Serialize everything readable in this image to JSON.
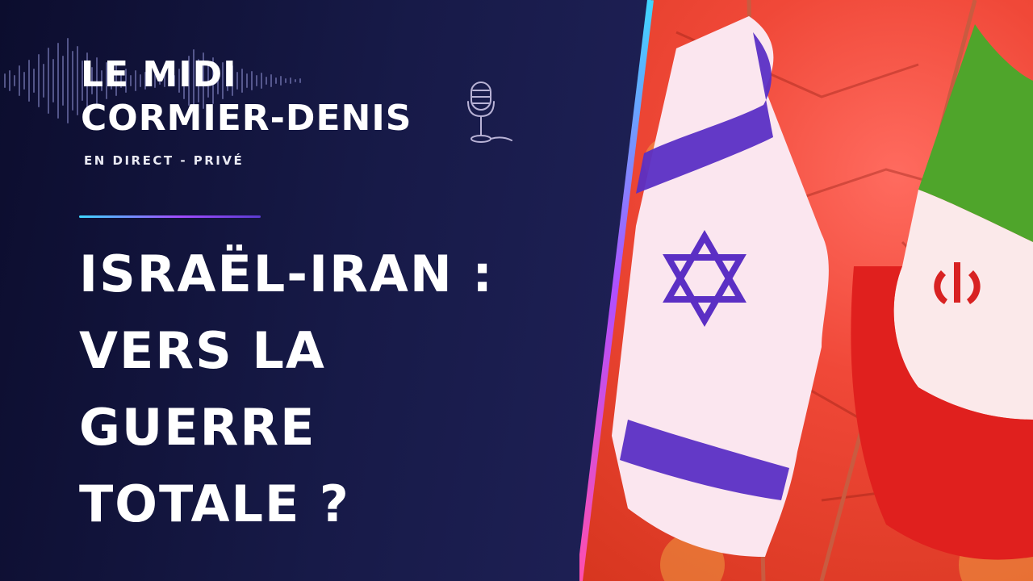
{
  "show": {
    "title_line1": "LE MIDI",
    "title_line2": "CORMIER-DENIS",
    "subtitle": "EN DIRECT - PRIVÉ"
  },
  "headline": {
    "line1": "ISRAËL-IRAN :",
    "line2": "VERS LA",
    "line3": "GUERRE",
    "line4": "TOTALE ?"
  },
  "colors": {
    "background": "#171940",
    "accent_cyan": "#3fd6ff",
    "accent_purple": "#a14cff",
    "photo_red": "#f04838",
    "israel_blue": "#5b2fc4",
    "iran_green": "#4fa52b",
    "iran_red": "#e0201e"
  },
  "icons": [
    "waveform-icon",
    "microphone-icon",
    "star-of-david-icon",
    "iran-emblem-icon"
  ]
}
